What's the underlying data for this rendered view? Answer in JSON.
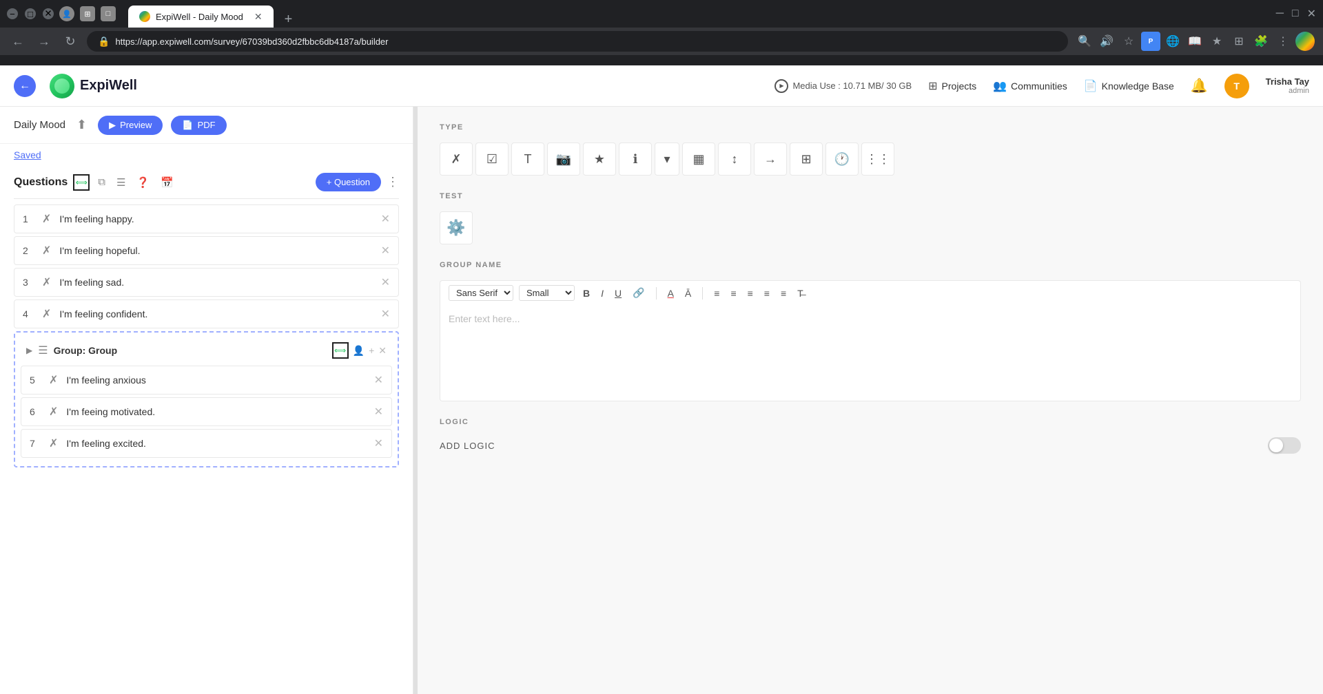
{
  "browser": {
    "url": "https://app.expiwell.com/survey/67039bd360d2fbbc6db4187a/builder",
    "tab_title": "ExpiWell - Daily Mood",
    "new_tab_label": "+"
  },
  "header": {
    "back_label": "←",
    "logo_text": "ExpiWell",
    "media_use_label": "Media Use : 10.71 MB/ 30 GB",
    "projects_label": "Projects",
    "communities_label": "Communities",
    "knowledge_base_label": "Knowledge Base",
    "user_name": "Trisha Tay",
    "user_role": "admin"
  },
  "left_panel": {
    "project_title": "Daily Mood",
    "saved_text": "Saved",
    "preview_btn": "Preview",
    "pdf_btn": "PDF",
    "questions_label": "Questions",
    "add_question_btn": "+ Question",
    "questions": [
      {
        "number": "1",
        "text": "I'm feeling happy."
      },
      {
        "number": "2",
        "text": "I'm feeling hopeful."
      },
      {
        "number": "3",
        "text": "I'm feeling sad."
      },
      {
        "number": "4",
        "text": "I'm feeling confident."
      }
    ],
    "group": {
      "label": "Group: Group",
      "questions": [
        {
          "number": "5",
          "text": "I'm feeling anxious"
        },
        {
          "number": "6",
          "text": "I'm feeing motivated."
        },
        {
          "number": "7",
          "text": "I'm feeling excited."
        }
      ]
    }
  },
  "right_panel": {
    "type_section_label": "TYPE",
    "type_icons": [
      "✗",
      "☑",
      "T",
      "📷",
      "★",
      "ℹ",
      "▾",
      "▦",
      "↕",
      "→",
      "⊞",
      "🕐",
      "⋮⋮"
    ],
    "test_section_label": "TEST",
    "group_name_label": "GROUP NAME",
    "font_family": "Sans Serif",
    "font_size": "Small",
    "text_placeholder": "Enter text here...",
    "logic_section_label": "LOGIC",
    "add_logic_label": "ADD LOGIC",
    "format_buttons": [
      "B",
      "I",
      "U",
      "🔗",
      "A",
      "Ā",
      "≡",
      "≡",
      "≡",
      "≡",
      "≡",
      "T̶"
    ]
  }
}
